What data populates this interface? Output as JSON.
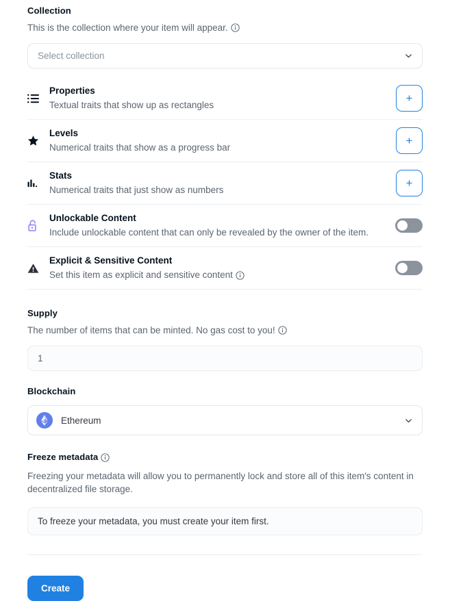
{
  "collection": {
    "label": "Collection",
    "description": "This is the collection where your item will appear.",
    "info_icon": "info-circle-icon",
    "select_placeholder": "Select collection",
    "chevron_icon": "chevron-down-icon"
  },
  "traits": [
    {
      "icon": "list-icon",
      "title": "Properties",
      "subtitle": "Textual traits that show up as rectangles",
      "action": "plus",
      "action_label": "+",
      "action_icon": "plus-icon"
    },
    {
      "icon": "star-icon",
      "title": "Levels",
      "subtitle": "Numerical traits that show as a progress bar",
      "action": "plus",
      "action_label": "+",
      "action_icon": "plus-icon"
    },
    {
      "icon": "bar-chart-icon",
      "title": "Stats",
      "subtitle": "Numerical traits that just show as numbers",
      "action": "plus",
      "action_label": "+",
      "action_icon": "plus-icon"
    },
    {
      "icon": "unlock-icon",
      "title": "Unlockable Content",
      "subtitle": "Include unlockable content that can only be revealed by the owner of the item.",
      "action": "toggle",
      "toggle_state": "off"
    },
    {
      "icon": "warning-triangle-icon",
      "title": "Explicit & Sensitive Content",
      "subtitle": "Set this item as explicit and sensitive content",
      "subtitle_info_icon": "info-circle-icon",
      "action": "toggle",
      "toggle_state": "off"
    }
  ],
  "supply": {
    "label": "Supply",
    "description": "The number of items that can be minted. No gas cost to you!",
    "info_icon": "info-circle-icon",
    "value": "1"
  },
  "blockchain": {
    "label": "Blockchain",
    "selected": "Ethereum",
    "icon": "ethereum-icon",
    "chevron_icon": "chevron-down-icon"
  },
  "freeze": {
    "label": "Freeze metadata",
    "info_icon": "info-circle-icon",
    "description": "Freezing your metadata will allow you to permanently lock and store all of this item's content in decentralized file storage.",
    "note": "To freeze your metadata, you must create your item first."
  },
  "footer": {
    "create_label": "Create"
  },
  "colors": {
    "accent_blue": "#2081e2",
    "text_primary": "#04111d",
    "text_secondary": "#5b6470",
    "placeholder": "#8a939b",
    "border": "#e5e8eb",
    "toggle_off": "#8b939d",
    "unlock_purple": "#8b7ff5",
    "ethereum_blue": "#627eea"
  }
}
